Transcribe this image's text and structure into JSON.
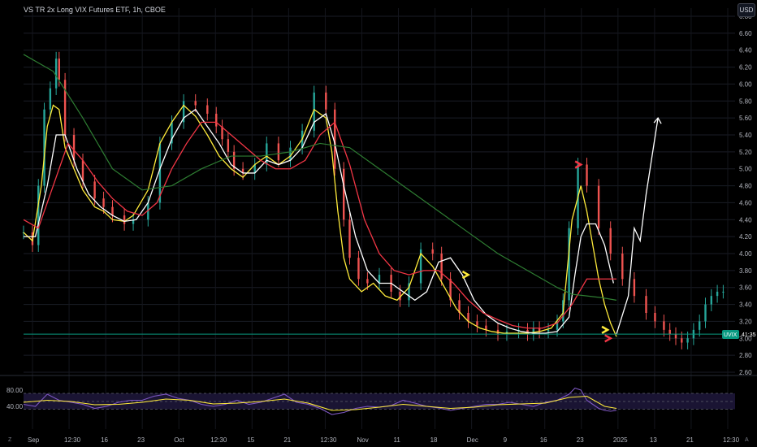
{
  "header": {
    "title": "VS TR 2x Long VIX Futures ETF, 1h, CBOE",
    "currency_button": "USD"
  },
  "price_tag": {
    "symbol": "UVIX",
    "time": "41:35",
    "color": "#089981"
  },
  "footer": {
    "left_icon": "Z",
    "right_icon": "A"
  },
  "chart_data": [
    {
      "type": "line",
      "panel": "price",
      "title": "VS TR 2x Long VIX Futures ETF, 1h, CBOE",
      "currency": "USD",
      "ylim": [
        2.6,
        6.8
      ],
      "yticks": [
        "6.80",
        "6.60",
        "6.40",
        "6.20",
        "6.00",
        "5.80",
        "5.60",
        "5.40",
        "5.20",
        "5.00",
        "4.80",
        "4.60",
        "4.40",
        "4.20",
        "4.00",
        "3.80",
        "3.60",
        "3.40",
        "3.20",
        "3.00",
        "2.80",
        "2.60"
      ],
      "xticks": [
        "Sep",
        "12:30",
        "16",
        "23",
        "Oct",
        "12:30",
        "15",
        "21",
        "12:30",
        "Nov",
        "11",
        "18",
        "Dec",
        "9",
        "16",
        "23",
        "2025",
        "13",
        "21",
        "12:30"
      ],
      "grid": true,
      "series": [
        {
          "key": "price",
          "style": "candles",
          "color": "#26a69a",
          "x": [
            0,
            3,
            5,
            7,
            9,
            11,
            12,
            14,
            17,
            20,
            24,
            27,
            30,
            34,
            37,
            42,
            46,
            50,
            54,
            58,
            62,
            65,
            67,
            69,
            71,
            74,
            78,
            82,
            86,
            90,
            94,
            98,
            102,
            105,
            108,
            110,
            113,
            116,
            120,
            124,
            127,
            130,
            134,
            138,
            141,
            144,
            147,
            150,
            153,
            156,
            160,
            163,
            167,
            170,
            172,
            174,
            177,
            180,
            182,
            184,
            187,
            190,
            194,
            198,
            202,
            206,
            210,
            213,
            216,
            218,
            220,
            222,
            224,
            226,
            228,
            230,
            232,
            234,
            236
          ],
          "y": [
            4.25,
            4.1,
            4.8,
            5.7,
            5.95,
            6.3,
            6.05,
            5.4,
            5.1,
            4.85,
            4.65,
            4.55,
            4.45,
            4.35,
            4.4,
            4.6,
            5.3,
            5.55,
            5.8,
            5.75,
            5.65,
            5.5,
            5.35,
            5.2,
            5.0,
            4.95,
            5.05,
            5.3,
            5.1,
            5.25,
            5.45,
            5.9,
            5.7,
            5.0,
            4.4,
            3.95,
            3.7,
            3.65,
            3.75,
            3.55,
            3.45,
            3.65,
            4.05,
            4.0,
            3.7,
            3.45,
            3.3,
            3.2,
            3.15,
            3.1,
            3.05,
            3.08,
            3.1,
            3.05,
            3.12,
            3.08,
            3.1,
            3.2,
            3.45,
            4.3,
            5.05,
            4.8,
            4.3,
            4.0,
            3.7,
            3.5,
            3.3,
            3.2,
            3.1,
            3.05,
            3.0,
            2.95,
            3.0,
            3.1,
            3.2,
            3.4,
            3.5,
            3.55,
            3.55
          ]
        },
        {
          "key": "ma_fast",
          "style": "line",
          "color": "#ffeb3b",
          "x": [
            0,
            3,
            6,
            8,
            10,
            12,
            14,
            17,
            20,
            24,
            27,
            30,
            34,
            37,
            42,
            46,
            50,
            54,
            58,
            62,
            66,
            70,
            74,
            78,
            82,
            86,
            90,
            94,
            98,
            102,
            104,
            106,
            108,
            110,
            114,
            118,
            122,
            126,
            130,
            134,
            138,
            142,
            146,
            150,
            154,
            158,
            162,
            166,
            170,
            174,
            178,
            182,
            185,
            188,
            190,
            192,
            194,
            196,
            198,
            200
          ],
          "y": [
            4.25,
            4.15,
            4.8,
            5.5,
            5.75,
            5.7,
            5.25,
            5.0,
            4.75,
            4.55,
            4.5,
            4.4,
            4.38,
            4.45,
            4.75,
            5.3,
            5.55,
            5.75,
            5.62,
            5.4,
            5.15,
            5.0,
            4.9,
            5.05,
            5.15,
            5.05,
            5.15,
            5.35,
            5.7,
            5.6,
            5.2,
            4.5,
            3.95,
            3.7,
            3.55,
            3.65,
            3.5,
            3.45,
            3.6,
            4.0,
            3.85,
            3.6,
            3.35,
            3.2,
            3.12,
            3.08,
            3.06,
            3.06,
            3.06,
            3.08,
            3.12,
            3.3,
            4.4,
            4.8,
            4.5,
            4.1,
            3.7,
            3.4,
            3.18,
            3.02
          ]
        },
        {
          "key": "ma_slow",
          "style": "line",
          "color": "#ffffff",
          "x": [
            0,
            4,
            8,
            11,
            14,
            18,
            22,
            26,
            30,
            34,
            38,
            42,
            46,
            50,
            54,
            58,
            62,
            66,
            70,
            74,
            78,
            82,
            86,
            90,
            94,
            98,
            102,
            105,
            108,
            112,
            116,
            120,
            124,
            128,
            132,
            136,
            140,
            144,
            148,
            152,
            156,
            160,
            164,
            168,
            172,
            176,
            180,
            184,
            186,
            188,
            190,
            193,
            196,
            199
          ],
          "y": [
            4.2,
            4.2,
            4.8,
            5.4,
            5.4,
            5.0,
            4.7,
            4.55,
            4.45,
            4.38,
            4.4,
            4.6,
            5.0,
            5.35,
            5.6,
            5.7,
            5.5,
            5.3,
            5.05,
            4.95,
            4.95,
            5.1,
            5.05,
            5.1,
            5.25,
            5.55,
            5.65,
            5.3,
            4.8,
            4.2,
            3.8,
            3.65,
            3.65,
            3.55,
            3.45,
            3.55,
            3.9,
            3.95,
            3.75,
            3.45,
            3.28,
            3.18,
            3.12,
            3.08,
            3.06,
            3.06,
            3.08,
            3.25,
            3.75,
            4.2,
            4.35,
            4.35,
            4.1,
            3.65
          ]
        },
        {
          "key": "ma_red",
          "style": "line",
          "color": "#f23645",
          "x": [
            0,
            5,
            10,
            15,
            20,
            25,
            30,
            35,
            40,
            45,
            50,
            55,
            60,
            65,
            70,
            75,
            80,
            85,
            90,
            95,
            100,
            105,
            110,
            115,
            120,
            125,
            130,
            135,
            140,
            145,
            150,
            155,
            160,
            165,
            170,
            175,
            180,
            185,
            190,
            195,
            200
          ],
          "y": [
            4.4,
            4.3,
            4.8,
            5.3,
            5.1,
            4.85,
            4.65,
            4.5,
            4.45,
            4.6,
            5.0,
            5.3,
            5.55,
            5.55,
            5.4,
            5.25,
            5.1,
            5.0,
            5.0,
            5.1,
            5.4,
            5.55,
            5.05,
            4.4,
            4.0,
            3.8,
            3.75,
            3.8,
            3.8,
            3.65,
            3.45,
            3.3,
            3.22,
            3.15,
            3.12,
            3.12,
            3.18,
            3.4,
            3.7,
            3.7,
            3.7
          ]
        },
        {
          "key": "ma_green",
          "style": "line",
          "color": "#2e7d32",
          "x": [
            0,
            10,
            20,
            30,
            40,
            50,
            60,
            70,
            80,
            90,
            100,
            110,
            120,
            130,
            140,
            150,
            160,
            170,
            180,
            185,
            190,
            195,
            200
          ],
          "y": [
            6.35,
            6.15,
            5.6,
            5.0,
            4.75,
            4.8,
            5.0,
            5.15,
            5.15,
            5.2,
            5.3,
            5.25,
            5.0,
            4.75,
            4.5,
            4.25,
            4.0,
            3.8,
            3.6,
            3.52,
            3.5,
            3.48,
            3.45
          ]
        },
        {
          "key": "projection",
          "style": "line",
          "color": "#ffffff",
          "x": [
            200,
            204,
            206,
            208,
            210,
            214
          ],
          "y": [
            3.05,
            3.5,
            4.3,
            4.15,
            4.7,
            5.6
          ]
        }
      ],
      "annotations": [
        {
          "kind": "marker",
          "color": "#f23645",
          "x": 188,
          "y": 5.05
        },
        {
          "kind": "marker",
          "color": "#f23645",
          "x": 198,
          "y": 3.0
        },
        {
          "kind": "marker",
          "color": "#ffeb3b",
          "x": 150,
          "y": 3.75
        },
        {
          "kind": "marker",
          "color": "#ffeb3b",
          "x": 197,
          "y": 3.1
        },
        {
          "kind": "hline",
          "color": "#089981",
          "y": 3.05
        }
      ]
    },
    {
      "type": "line",
      "panel": "oscillator",
      "ylim": [
        0,
        100
      ],
      "yticks": [
        "80.00",
        "40.00"
      ],
      "band": [
        33,
        72
      ],
      "series": [
        {
          "key": "osc",
          "color": "#7e57c2",
          "x": [
            0,
            4,
            8,
            12,
            16,
            20,
            24,
            28,
            32,
            36,
            40,
            44,
            48,
            52,
            56,
            60,
            64,
            68,
            72,
            76,
            80,
            84,
            88,
            92,
            96,
            100,
            104,
            108,
            112,
            116,
            120,
            124,
            128,
            132,
            136,
            140,
            144,
            148,
            152,
            156,
            160,
            164,
            168,
            172,
            176,
            180,
            184,
            186,
            188,
            190,
            192,
            194,
            196,
            198,
            200
          ],
          "y": [
            45,
            40,
            70,
            55,
            50,
            45,
            35,
            40,
            50,
            55,
            55,
            65,
            70,
            60,
            55,
            45,
            40,
            45,
            55,
            45,
            50,
            60,
            70,
            50,
            45,
            35,
            20,
            25,
            35,
            40,
            38,
            42,
            55,
            48,
            40,
            36,
            30,
            35,
            40,
            45,
            45,
            50,
            45,
            40,
            50,
            55,
            70,
            85,
            80,
            55,
            45,
            35,
            30,
            28,
            30
          ]
        },
        {
          "key": "osc_signal",
          "color": "#ffeb3b",
          "x": [
            0,
            8,
            16,
            24,
            32,
            40,
            48,
            56,
            64,
            72,
            80,
            88,
            96,
            104,
            112,
            120,
            128,
            136,
            144,
            152,
            160,
            168,
            176,
            184,
            190,
            196,
            200
          ],
          "y": [
            50,
            55,
            52,
            44,
            45,
            50,
            58,
            55,
            46,
            48,
            52,
            58,
            48,
            30,
            32,
            38,
            45,
            40,
            35,
            38,
            44,
            46,
            48,
            62,
            65,
            40,
            35
          ]
        }
      ]
    }
  ]
}
